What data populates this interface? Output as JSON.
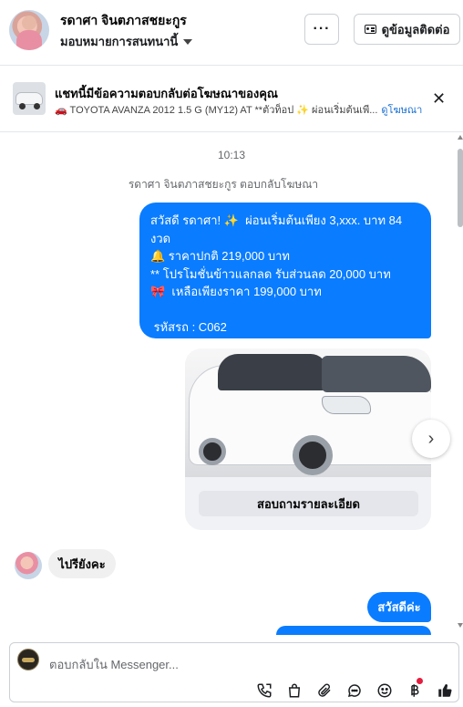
{
  "header": {
    "contact_name": "รดาศา จินตภาสชยะกูร",
    "assign_label": "มอบหมายการสนทนานี้",
    "more_label": "···",
    "contact_info_label": "ดูข้อมูลติดต่อ"
  },
  "ad": {
    "title": "แชทนี้มีข้อความตอบกลับต่อโฆษณาของคุณ",
    "subtitle": "🚗 TOYOTA AVANZA 2012 1.5 G (MY12) AT **ตัวท็อป ✨ ผ่อนเริ่มต้นเพี...",
    "link_label": "ดูโฆษณา",
    "close_label": "✕"
  },
  "conversation": {
    "time": "10:13",
    "notice": "รดาศา จินตภาสชยะกูร ตอบกลับโฆษณา",
    "ad_message": "สวัสดี รดาศา! ✨  ผ่อนเริ่มต้นเพียง 3,xxx. บาท 84 งวด\n🔔 ราคาปกติ 219,000 บาท\n** โปรโมชั่นข้าวแลกลด รับส่วนลด 20,000 บาท\n🎀  เหลือเพียงราคา 199,000 บาท\n\n รหัสรถ : C062",
    "card_button_label": "สอบถามรายละเอียด",
    "next_label": "›",
    "reply_customer": "ไปรียังคะ",
    "reply_page": "สวัสดีค่ะ"
  },
  "composer": {
    "placeholder": "ตอบกลับใน Messenger..."
  },
  "icons": [
    "call-icon",
    "shopping-bag-icon",
    "attach-icon",
    "chat-bubble-icon",
    "emoji-icon",
    "baht-icon",
    "thumbs-up-icon"
  ],
  "colors": {
    "messenger_blue": "#0a7cff",
    "link_blue": "#1a6fd1",
    "bubble_gray": "#f0f0f0",
    "notification_red": "#e41e3f"
  }
}
